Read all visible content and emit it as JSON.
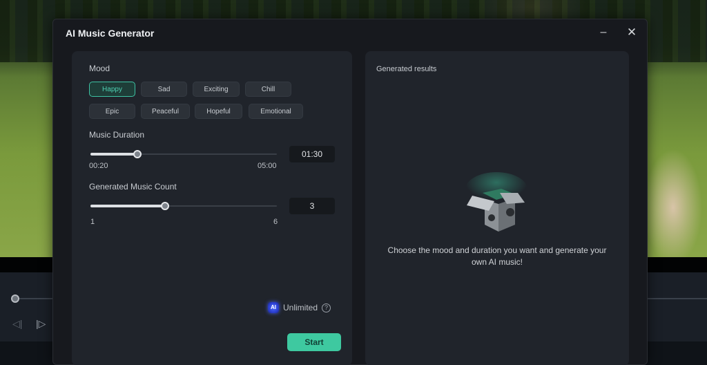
{
  "dialog": {
    "title": "AI Music Generator",
    "minimize_icon": "minimize-icon",
    "close_icon": "close-icon"
  },
  "mood": {
    "label": "Mood",
    "selected": "Happy",
    "options": [
      "Happy",
      "Sad",
      "Exciting",
      "Chill",
      "Epic",
      "Peaceful",
      "Hopeful",
      "Emotional"
    ]
  },
  "duration": {
    "label": "Music Duration",
    "min_label": "00:20",
    "max_label": "05:00",
    "value": "01:30",
    "min_seconds": 20,
    "max_seconds": 300,
    "value_seconds": 90
  },
  "count": {
    "label": "Generated Music Count",
    "min_label": "1",
    "max_label": "6",
    "value": "3",
    "min": 1,
    "max": 6,
    "current": 3
  },
  "quota": {
    "badge": "AI",
    "text": "Unlimited",
    "help": "?"
  },
  "start_label": "Start",
  "results": {
    "label": "Generated results",
    "empty_icon": "empty-box-icon",
    "empty_message": "Choose the mood and duration you want and generate your own AI music!"
  },
  "background": {
    "prev_icon": "◁|",
    "next_icon": "|▷"
  },
  "colors": {
    "accent": "#3ec9a0",
    "dialog_bg": "#17191e",
    "panel_bg": "#20242b"
  }
}
